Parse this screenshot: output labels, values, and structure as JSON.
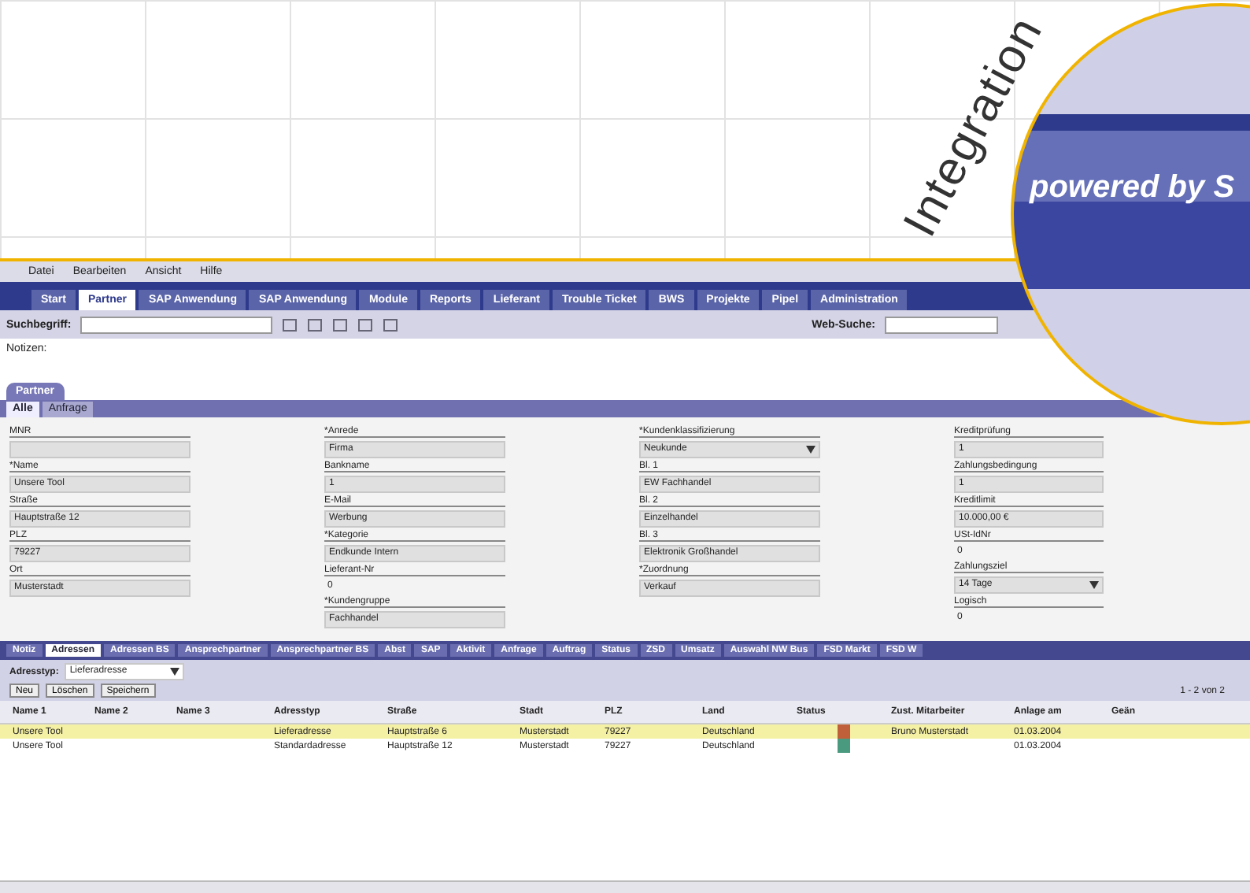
{
  "heading": "Integration",
  "magnifier": {
    "text": "powered by S"
  },
  "menu": [
    "Datei",
    "Bearbeiten",
    "Ansicht",
    "Hilfe"
  ],
  "main_tabs": [
    {
      "label": "Start",
      "selected": false
    },
    {
      "label": "Partner",
      "selected": true
    },
    {
      "label": "SAP Anwendung",
      "selected": false
    },
    {
      "label": "SAP Anwendung",
      "selected": false
    },
    {
      "label": "Module",
      "selected": false
    },
    {
      "label": "Reports",
      "selected": false
    },
    {
      "label": "Lieferant",
      "selected": false
    },
    {
      "label": "Trouble Ticket",
      "selected": false
    },
    {
      "label": "BWS",
      "selected": false
    },
    {
      "label": "Projekte",
      "selected": false
    },
    {
      "label": "Pipel",
      "selected": false
    },
    {
      "label": "Administration",
      "selected": false
    }
  ],
  "toolbar": {
    "search_label": "Suchbegriff:",
    "web_search_label": "Web-Suche:"
  },
  "notes_label": "Notizen:",
  "section_tab": "Partner",
  "sub_tabs": [
    {
      "label": "Alle",
      "selected": true
    },
    {
      "label": "Anfrage",
      "selected": false
    }
  ],
  "form_columns": [
    [
      {
        "label": "MNR",
        "kind": "text"
      },
      {
        "label": "*Name",
        "value": "Unsere Tool",
        "kind": "text"
      },
      {
        "label": "Straße",
        "value": "Hauptstraße 12",
        "kind": "text"
      },
      {
        "label": "PLZ",
        "value": "79227",
        "kind": "text"
      },
      {
        "label": "Ort",
        "value": "Musterstadt",
        "kind": "text"
      }
    ],
    [
      {
        "label": "*Anrede",
        "value": "Firma",
        "kind": "text"
      },
      {
        "label": "Bankname",
        "value": "1",
        "kind": "text"
      },
      {
        "label": "E-Mail",
        "value": "Werbung",
        "kind": "text"
      },
      {
        "label": "*Kategorie",
        "value": "Endkunde Intern",
        "kind": "text"
      },
      {
        "label": "Lieferant-Nr",
        "value": "0",
        "kind": "plain"
      },
      {
        "label": "*Kundengruppe",
        "value": "Fachhandel",
        "kind": "text"
      }
    ],
    [
      {
        "label": "*Kundenklassifizierung",
        "value": "Neukunde",
        "kind": "select"
      },
      {
        "label": "Bl. 1",
        "value": "EW Fachhandel",
        "kind": "text"
      },
      {
        "label": "Bl. 2",
        "value": "Einzelhandel",
        "kind": "text"
      },
      {
        "label": "Bl. 3",
        "value": "Elektronik Großhandel",
        "kind": "text"
      },
      {
        "label": "*Zuordnung",
        "value": "Verkauf",
        "kind": "text"
      }
    ],
    [
      {
        "label": "Kreditprüfung",
        "value": "1",
        "kind": "text"
      },
      {
        "label": "Zahlungsbedingung",
        "value": "1",
        "kind": "text"
      },
      {
        "label": "Kreditlimit",
        "value": "10.000,00 €",
        "kind": "text"
      },
      {
        "label": "USt-IdNr",
        "value": "0",
        "kind": "plain"
      },
      {
        "label": "Zahlungsziel",
        "value": "14 Tage",
        "kind": "select"
      },
      {
        "label": "Logisch",
        "value": "0",
        "kind": "plain"
      }
    ]
  ],
  "bottom_tabs": [
    {
      "label": "Notiz",
      "selected": false
    },
    {
      "label": "Adressen",
      "selected": true
    },
    {
      "label": "Adressen BS",
      "selected": false
    },
    {
      "label": "Ansprechpartner",
      "selected": false
    },
    {
      "label": "Ansprechpartner BS",
      "selected": false
    },
    {
      "label": "Abst",
      "selected": false
    },
    {
      "label": "SAP",
      "selected": false
    },
    {
      "label": "Aktivit",
      "selected": false
    },
    {
      "label": "Anfrage",
      "selected": false
    },
    {
      "label": "Auftrag",
      "selected": false
    },
    {
      "label": "Status",
      "selected": false
    },
    {
      "label": "ZSD",
      "selected": false
    },
    {
      "label": "Umsatz",
      "selected": false
    },
    {
      "label": "Auswahl NW Bus",
      "selected": false
    },
    {
      "label": "FSD Markt",
      "selected": false
    },
    {
      "label": "FSD W",
      "selected": false
    }
  ],
  "filter": {
    "label": "Adresstyp:",
    "value": "Lieferadresse",
    "buttons": [
      "Neu",
      "Löschen",
      "Speichern"
    ],
    "pager": "1 - 2 von 2"
  },
  "table": {
    "columns": [
      "Name 1",
      "Name 2",
      "Name 3",
      "Adresstyp",
      "Straße",
      "Stadt",
      "PLZ",
      "Land",
      "Status",
      "Zust. Mitarbeiter",
      "Anlage am",
      "Geän"
    ],
    "rows": [
      {
        "selected": true,
        "color": "#c0603a",
        "cells": [
          "Unsere Tool",
          "",
          "",
          "Lieferadresse",
          "Hauptstraße 6",
          "Musterstadt",
          "79227",
          "Deutschland",
          "",
          "Bruno Musterstadt",
          "01.03.2004",
          ""
        ]
      },
      {
        "selected": false,
        "color": "#4a9a80",
        "cells": [
          "Unsere Tool",
          "",
          "",
          "Standardadresse",
          "Hauptstraße 12",
          "Musterstadt",
          "79227",
          "Deutschland",
          "",
          "",
          "01.03.2004",
          ""
        ]
      }
    ]
  }
}
